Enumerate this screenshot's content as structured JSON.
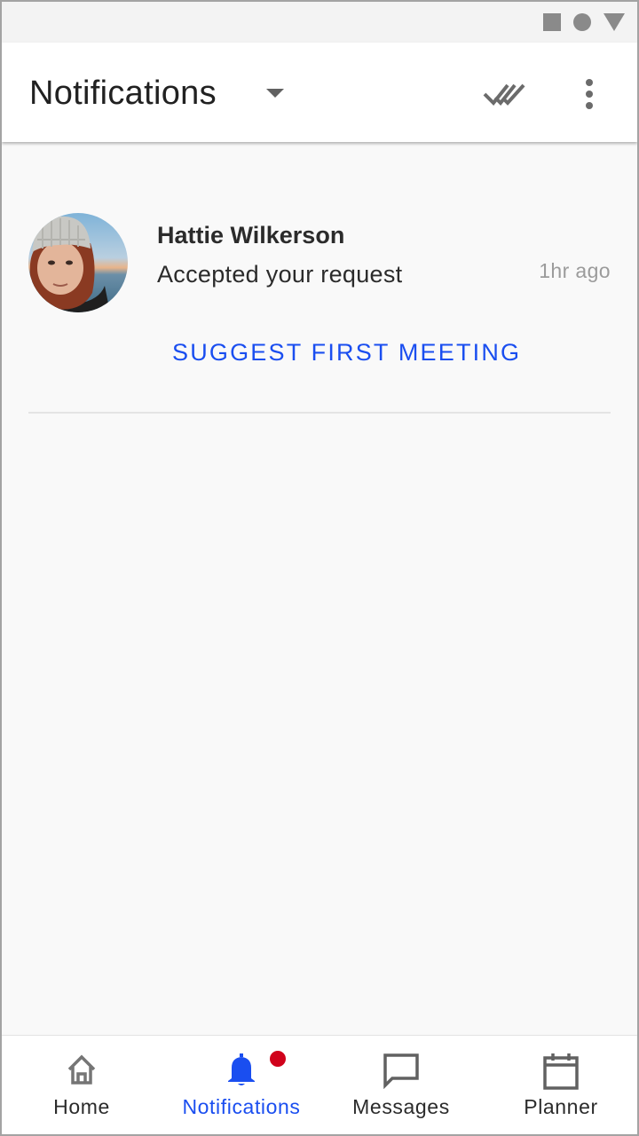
{
  "status_bar": {
    "icons": [
      "square-icon",
      "circle-icon",
      "triangle-icon"
    ]
  },
  "app_bar": {
    "title": "Notifications",
    "actions": [
      "mark-all-read-icon",
      "more-vert-icon"
    ]
  },
  "notifications": [
    {
      "sender": "Hattie Wilkerson",
      "message": "Accepted your request",
      "time": "1hr ago",
      "action": "SUGGEST FIRST MEETING"
    }
  ],
  "bottom_nav": {
    "items": [
      {
        "label": "Home",
        "icon": "home-icon",
        "active": false
      },
      {
        "label": "Notifications",
        "icon": "bell-icon",
        "active": true,
        "badge": true
      },
      {
        "label": "Messages",
        "icon": "chat-icon",
        "active": false
      },
      {
        "label": "Planner",
        "icon": "calendar-icon",
        "active": false
      }
    ]
  },
  "colors": {
    "accent": "#1a4ef0",
    "badge": "#d0021b",
    "text": "#2b2b2b",
    "muted": "#9b9b9b",
    "background": "#f9f9f9"
  }
}
